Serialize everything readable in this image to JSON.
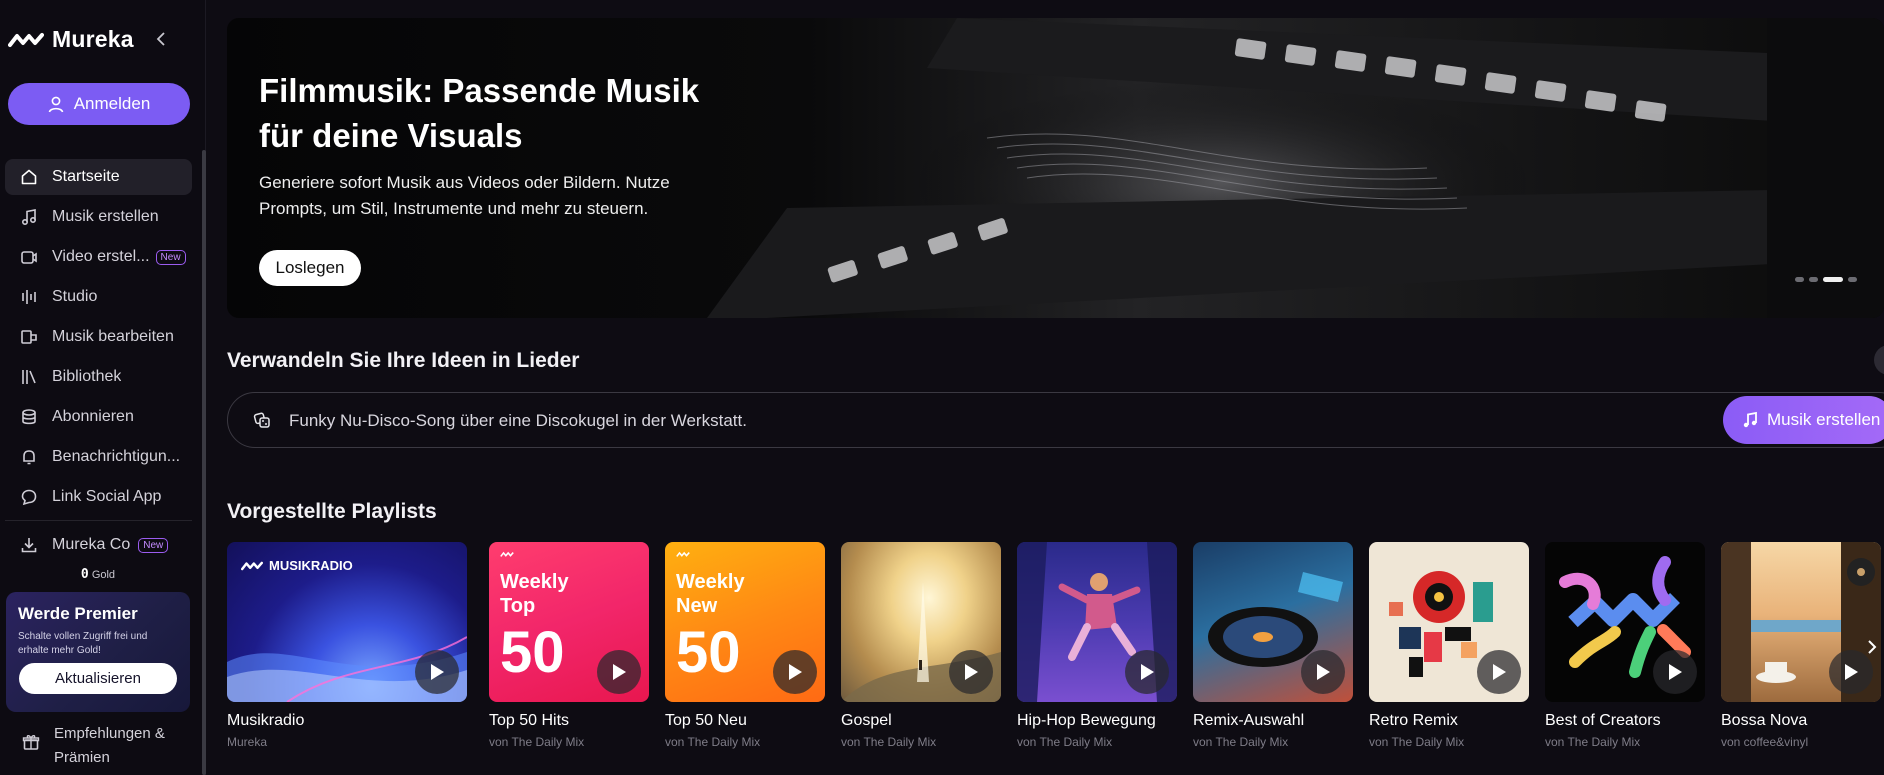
{
  "app": {
    "name": "Mureka"
  },
  "sidebar": {
    "login_label": "Anmelden",
    "items": [
      {
        "label": "Startseite",
        "icon": "home-icon",
        "active": true
      },
      {
        "label": "Musik erstellen",
        "icon": "music-note-icon"
      },
      {
        "label": "Video erstel...",
        "icon": "video-icon",
        "badge": "New"
      },
      {
        "label": "Studio",
        "icon": "studio-icon"
      },
      {
        "label": "Musik bearbeiten",
        "icon": "edit-music-icon"
      },
      {
        "label": "Bibliothek",
        "icon": "library-icon"
      },
      {
        "label": "Abonnieren",
        "icon": "subscribe-icon"
      },
      {
        "label": "Benachrichtigun...",
        "icon": "bell-icon"
      },
      {
        "label": "Link Social App",
        "icon": "chat-icon"
      }
    ],
    "mureka_co": {
      "label": "Mureka Co",
      "badge": "New",
      "icon": "download-icon"
    },
    "gold": {
      "amount": "0",
      "unit": "Gold"
    },
    "premier": {
      "title": "Werde Premier",
      "subtitle": "Schalte vollen Zugriff frei und erhalte mehr Gold!",
      "button": "Aktualisieren"
    },
    "rewards": {
      "label": "Empfehlungen & Prämien",
      "icon": "gift-icon"
    }
  },
  "hero": {
    "title": "Filmmusik: Passende Musik für deine Visuals",
    "description": "Generiere sofort Musik aus Videos oder Bildern. Nutze Prompts, um Stil, Instrumente und mehr zu steuern.",
    "button": "Loslegen",
    "slides": 4,
    "active_slide": 3
  },
  "create": {
    "heading": "Verwandeln Sie Ihre Ideen in Lieder",
    "prompt_text": "Funky Nu-Disco-Song über eine Discokugel in der Werkstatt.",
    "button": "Musik erstellen"
  },
  "playlists": {
    "heading": "Vorgestellte Playlists",
    "items": [
      {
        "name": "Musikradio",
        "by": "Mureka",
        "cover_label": "MUSIKRADIO"
      },
      {
        "name": "Top 50 Hits",
        "by": "von The Daily Mix",
        "cover_line1": "Weekly",
        "cover_line2": "Top",
        "cover_num": "50"
      },
      {
        "name": "Top 50 Neu",
        "by": "von The Daily Mix",
        "cover_line1": "Weekly",
        "cover_line2": "New",
        "cover_num": "50"
      },
      {
        "name": "Gospel",
        "by": "von The Daily Mix"
      },
      {
        "name": "Hip-Hop Bewegung",
        "by": "von The Daily Mix"
      },
      {
        "name": "Remix-Auswahl",
        "by": "von The Daily Mix"
      },
      {
        "name": "Retro Remix",
        "by": "von The Daily Mix"
      },
      {
        "name": "Best of Creators",
        "by": "von The Daily Mix"
      },
      {
        "name": "Bossa Nova",
        "by": "von coffee&vinyl"
      }
    ]
  }
}
